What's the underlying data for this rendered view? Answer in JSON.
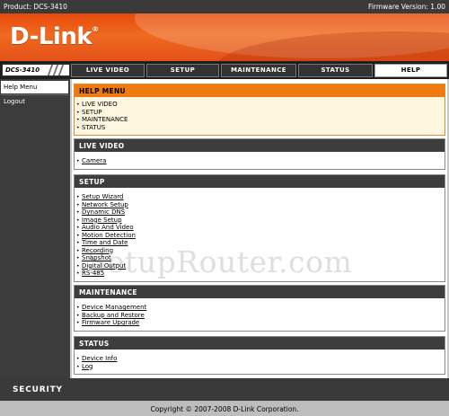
{
  "topbar": {
    "product": "Product: DCS-3410",
    "firmware": "Firmware Version: 1.00"
  },
  "brand": {
    "logo": "D-Link",
    "reg": "®"
  },
  "nav": {
    "model": "DCS-3410",
    "tabs": [
      "LIVE VIDEO",
      "SETUP",
      "MAINTENANCE",
      "STATUS",
      "HELP"
    ],
    "active_tab": "HELP"
  },
  "sidebar": {
    "items": [
      "Help Menu",
      "Logout"
    ]
  },
  "help_menu": {
    "title": "HELP MENU",
    "items": [
      "LIVE VIDEO",
      "SETUP",
      "MAINTENANCE",
      "STATUS"
    ]
  },
  "sections": [
    {
      "title": "LIVE VIDEO",
      "links": [
        "Camera"
      ]
    },
    {
      "title": "SETUP",
      "links": [
        "Setup Wizard",
        "Network Setup",
        "Dynamic DNS",
        "Image Setup",
        "Audio And Video",
        "Motion Detection",
        "Time and Date",
        "Recording",
        "Snapshot",
        "Digital Output",
        "RS-485"
      ]
    },
    {
      "title": "MAINTENANCE",
      "links": [
        "Device Management",
        "Backup and Restore",
        "Firmware Upgrade"
      ]
    },
    {
      "title": "STATUS",
      "links": [
        "Device Info",
        "Log"
      ]
    }
  ],
  "watermark": "SetupRouter.com",
  "footer": {
    "security": "SECURITY",
    "copyright": "Copyright © 2007-2008 D-Link Corporation."
  },
  "colors": {
    "accent": "#f07a10",
    "banner": "#e64a0b",
    "dark": "#3a3a3a"
  }
}
